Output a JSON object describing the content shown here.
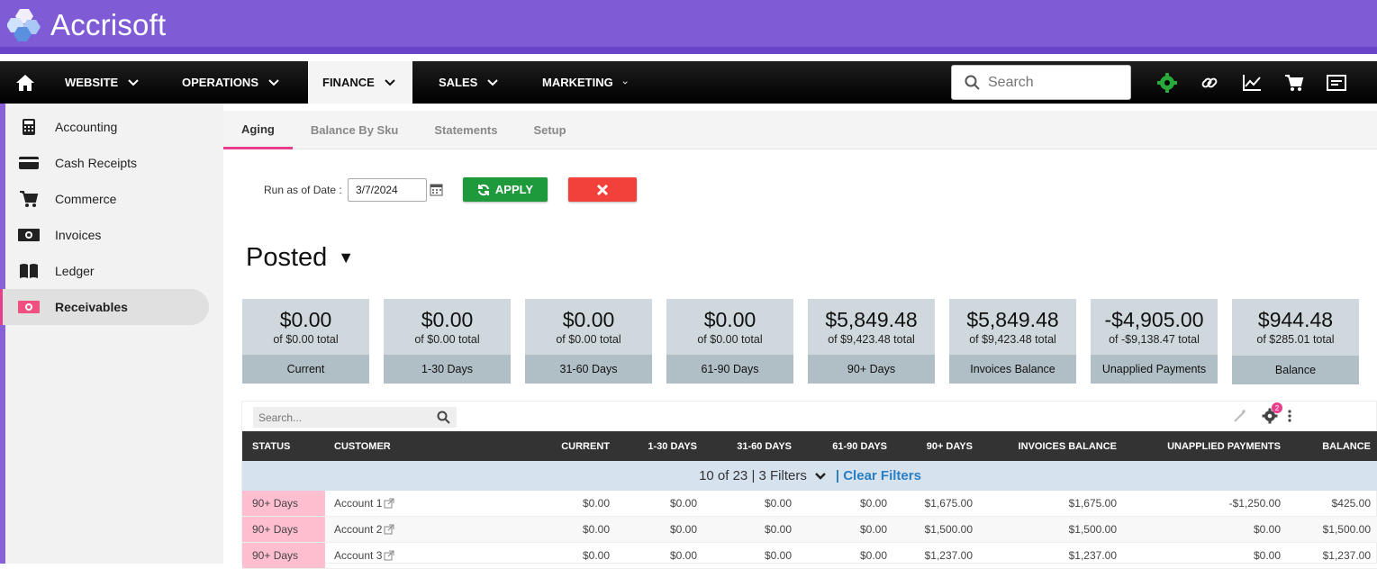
{
  "app": {
    "name": "Accrisoft"
  },
  "nav": {
    "items": [
      {
        "label": "WEBSITE"
      },
      {
        "label": "OPERATIONS"
      },
      {
        "label": "FINANCE"
      },
      {
        "label": "SALES"
      },
      {
        "label": "MARKETING"
      }
    ],
    "active": "FINANCE",
    "search_placeholder": "Search",
    "icons": [
      "gear-icon",
      "link-icon",
      "chart-icon",
      "cart-icon",
      "card-icon"
    ]
  },
  "sidebar": {
    "items": [
      {
        "label": "Accounting",
        "icon": "calculator-icon"
      },
      {
        "label": "Cash Receipts",
        "icon": "credit-card-icon"
      },
      {
        "label": "Commerce",
        "icon": "cart-icon"
      },
      {
        "label": "Invoices",
        "icon": "money-icon"
      },
      {
        "label": "Ledger",
        "icon": "book-icon"
      },
      {
        "label": "Receivables",
        "icon": "money-pink-icon"
      }
    ],
    "active": "Receivables"
  },
  "tabs": [
    {
      "label": "Aging"
    },
    {
      "label": "Balance By Sku"
    },
    {
      "label": "Statements"
    },
    {
      "label": "Setup"
    }
  ],
  "filters": {
    "run_label": "Run as of Date :",
    "date_value": "3/7/2024",
    "apply_label": "APPLY"
  },
  "view": {
    "title": "Posted"
  },
  "cards": [
    {
      "amount": "$0.00",
      "total": "of $0.00 total",
      "label": "Current"
    },
    {
      "amount": "$0.00",
      "total": "of $0.00 total",
      "label": "1-30 Days"
    },
    {
      "amount": "$0.00",
      "total": "of $0.00 total",
      "label": "31-60 Days"
    },
    {
      "amount": "$0.00",
      "total": "of $0.00 total",
      "label": "61-90 Days"
    },
    {
      "amount": "$5,849.48",
      "total": "of $9,423.48 total",
      "label": "90+ Days"
    },
    {
      "amount": "$5,849.48",
      "total": "of $9,423.48 total",
      "label": "Invoices Balance"
    },
    {
      "amount": "-$4,905.00",
      "total": "of -$9,138.47 total",
      "label": "Unapplied Payments"
    },
    {
      "amount": "$944.48",
      "total": "of $285.01 total",
      "label": "Balance"
    }
  ],
  "grid": {
    "search_placeholder": "Search...",
    "settings_badge": "2",
    "columns": [
      "STATUS",
      "CUSTOMER",
      "CURRENT",
      "1-30 DAYS",
      "31-60 DAYS",
      "61-90 DAYS",
      "90+ DAYS",
      "INVOICES BALANCE",
      "UNAPPLIED PAYMENTS",
      "BALANCE"
    ],
    "filter_summary": "10 of 23 | 3 Filters",
    "clear_filters": "| Clear Filters",
    "rows": [
      {
        "status": "90+ Days",
        "customer": "Account 1",
        "current": "$0.00",
        "d1_30": "$0.00",
        "d31_60": "$0.00",
        "d61_90": "$0.00",
        "d90": "$1,675.00",
        "inv_balance": "$1,675.00",
        "unapplied": "-$1,250.00",
        "balance": "$425.00"
      },
      {
        "status": "90+ Days",
        "customer": "Account 2",
        "current": "$0.00",
        "d1_30": "$0.00",
        "d31_60": "$0.00",
        "d61_90": "$0.00",
        "d90": "$1,500.00",
        "inv_balance": "$1,500.00",
        "unapplied": "$0.00",
        "balance": "$1,500.00"
      },
      {
        "status": "90+ Days",
        "customer": "Account 3",
        "current": "$0.00",
        "d1_30": "$0.00",
        "d31_60": "$0.00",
        "d61_90": "$0.00",
        "d90": "$1,237.00",
        "inv_balance": "$1,237.00",
        "unapplied": "$0.00",
        "balance": "$1,237.00"
      }
    ]
  },
  "colors": {
    "brand": "#7f5cd6",
    "apply": "#1e9a3c",
    "clear": "#f2403b",
    "status_pink": "#ffbfd1",
    "accent": "#e83e8c"
  }
}
